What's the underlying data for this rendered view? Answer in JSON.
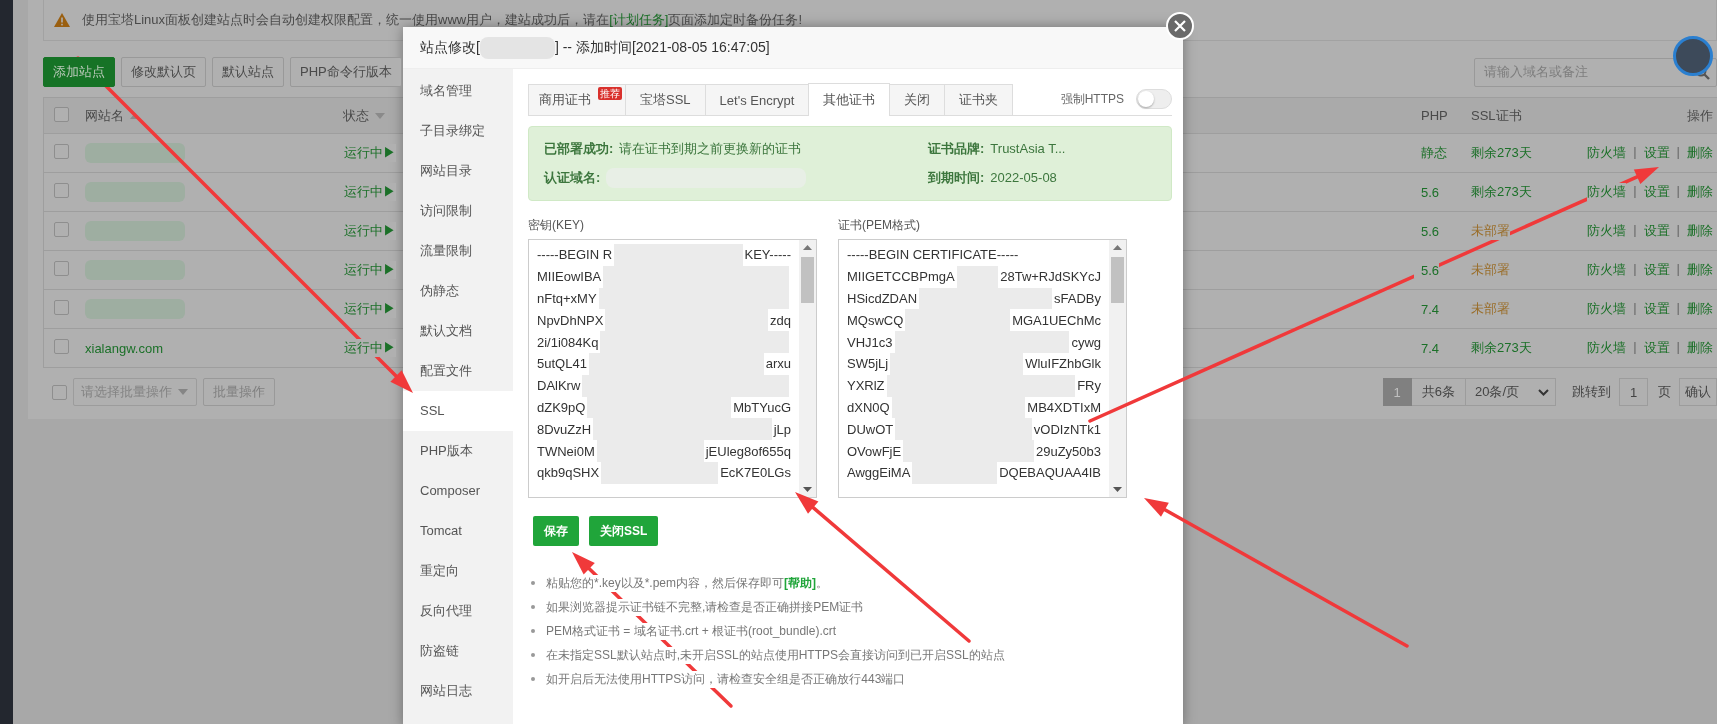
{
  "notice": {
    "text": "使用宝塔Linux面板创建站点时会自动创建权限配置，统一使用www用户，建站成功后，请在",
    "link": "[计划任务]",
    "after": "页面添加定时备份任务!"
  },
  "toolbar": [
    {
      "label": "添加站点",
      "kind": "primary"
    },
    {
      "label": "修改默认页",
      "kind": "default"
    },
    {
      "label": "默认站点",
      "kind": "default"
    },
    {
      "label": "PHP命令行版本",
      "kind": "default"
    }
  ],
  "search": {
    "placeholder": "请输入域名或备注"
  },
  "table": {
    "checked": false,
    "columns": [
      {
        "label": "网站名",
        "sort_ascending": true
      },
      {
        "label": "状态",
        "sort_ascending": false
      },
      {
        "label": "PHP"
      },
      {
        "label": "SSL证书"
      },
      {
        "label": "操作"
      }
    ],
    "rows": [
      {
        "checked": false,
        "status": "运行中▶",
        "php": "静态",
        "ssl": "剩余273天",
        "ssl_deployed": true,
        "actions": [
          "防火墙",
          "|",
          "设置",
          "|",
          "删除"
        ]
      },
      {
        "checked": false,
        "status": "运行中▶",
        "php": "5.6",
        "ssl": "剩余273天",
        "ssl_deployed": true,
        "actions": [
          "防火墙",
          "|",
          "设置",
          "|",
          "删除"
        ]
      },
      {
        "checked": false,
        "status": "运行中▶",
        "php": "5.6",
        "ssl": "未部署",
        "ssl_deployed": false,
        "actions": [
          "防火墙",
          "|",
          "设置",
          "|",
          "删除"
        ]
      },
      {
        "checked": false,
        "status": "运行中▶",
        "php": "5.6",
        "ssl": "未部署",
        "ssl_deployed": false,
        "actions": [
          "防火墙",
          "|",
          "设置",
          "|",
          "删除"
        ]
      },
      {
        "checked": false,
        "status": "运行中▶",
        "php": "7.4",
        "ssl": "未部署",
        "ssl_deployed": false,
        "actions": [
          "防火墙",
          "|",
          "设置",
          "|",
          "删除"
        ]
      },
      {
        "checked": false,
        "name": "xialangw.com",
        "status": "运行中▶",
        "php": "7.4",
        "ssl": "剩余273天",
        "ssl_deployed": true,
        "actions": [
          "防火墙",
          "|",
          "设置",
          "|",
          "删除"
        ]
      }
    ]
  },
  "batch": {
    "checked": false,
    "placeholder": "请选择批量操作",
    "button": "批量操作"
  },
  "pagination": {
    "pages": [
      {
        "label": "1",
        "selected": true
      }
    ],
    "total": "共6条",
    "page_size": "20条/页",
    "jump_label": "跳转到",
    "jump_value": "1",
    "page_unit": "页",
    "confirm": "确认"
  },
  "dialog": {
    "title": "站点修改[",
    "title_after": "] -- 添加时间[2021-08-05 16:47:05]",
    "menu": [
      {
        "label": "域名管理",
        "selected": false
      },
      {
        "label": "子目录绑定",
        "selected": false
      },
      {
        "label": "网站目录",
        "selected": false
      },
      {
        "label": "访问限制",
        "selected": false
      },
      {
        "label": "流量限制",
        "selected": false
      },
      {
        "label": "伪静态",
        "selected": false
      },
      {
        "label": "默认文档",
        "selected": false
      },
      {
        "label": "配置文件",
        "selected": false
      },
      {
        "label": "SSL",
        "selected": true
      },
      {
        "label": "PHP版本",
        "selected": false
      },
      {
        "label": "Composer",
        "selected": false
      },
      {
        "label": "Tomcat",
        "selected": false
      },
      {
        "label": "重定向",
        "selected": false
      },
      {
        "label": "反向代理",
        "selected": false
      },
      {
        "label": "防盗链",
        "selected": false
      },
      {
        "label": "网站日志",
        "selected": false
      }
    ],
    "tabs": [
      {
        "label": "商用证书",
        "selected": false,
        "badge": "推荐"
      },
      {
        "label": "宝塔SSL",
        "selected": false
      },
      {
        "label": "Let's Encrypt",
        "selected": false
      },
      {
        "label": "其他证书",
        "selected": true
      },
      {
        "label": "关闭",
        "selected": false
      },
      {
        "label": "证书夹",
        "selected": false
      }
    ],
    "force_https": {
      "label": "强制HTTPS",
      "on": false
    },
    "status": {
      "deployed_label": "已部署成功:",
      "deployed_text": "请在证书到期之前更换新的证书",
      "domain_label": "认证域名:",
      "brand_label": "证书品牌:",
      "brand": "TrustAsia T...",
      "expiry_label": "到期时间:",
      "expiry": "2022-05-08"
    },
    "key": {
      "label": "密钥(KEY)",
      "lines": [
        {
          "left": "-----BEGIN R",
          "right": "KEY-----"
        },
        {
          "left": "MIIEowIBA"
        },
        {
          "left": "nFtq+xMY"
        },
        {
          "left": "NpvDhNPX",
          "right": "zdq"
        },
        {
          "left": "2i/1i084Kq"
        },
        {
          "left": "5utQL41",
          "right": "arxu"
        },
        {
          "left": "DAlKrw"
        },
        {
          "left": "dZK9pQ",
          "right": "MbTYucG"
        },
        {
          "left": "8DvuZzH",
          "right": "jLp"
        },
        {
          "left": "TWNei0M",
          "right": "jEUleg8of655q"
        },
        {
          "left": "qkb9qSHX",
          "right": "EcK7E0LGs"
        }
      ]
    },
    "cert": {
      "label": "证书(PEM格式)",
      "lines": [
        {
          "text": "-----BEGIN CERTIFICATE-----"
        },
        {
          "left": "MIIGETCCBPmgA",
          "right": "28Tw+RJdSKYcJ"
        },
        {
          "left": "HSicdZDAN",
          "right": "sFADBy"
        },
        {
          "left": "MQswCQ",
          "right": "MGA1UEChMc"
        },
        {
          "left": "VHJ1c3",
          "right": "cywg"
        },
        {
          "left": "SW5jLj",
          "right": "WluIFZhbGlk"
        },
        {
          "left": "YXRlZ",
          "right": "FRy"
        },
        {
          "left": "dXN0Q",
          "right": "MB4XDTIxM"
        },
        {
          "left": "DUwOT",
          "right": "vODIzNTk1"
        },
        {
          "left": "OVowFjE",
          "right": "29uZy50b3"
        },
        {
          "left": "AwggEiMA",
          "right": "DQEBAQUAA4IB"
        }
      ]
    },
    "buttons": [
      "保存",
      "关闭SSL"
    ],
    "notes": [
      {
        "text": "粘贴您的*.key以及*.pem内容，然后保存即可",
        "link": "[帮助]",
        "after": "。"
      },
      {
        "text": "如果浏览器提示证书链不完整,请检查是否正确拼接PEM证书"
      },
      {
        "text": "PEM格式证书 = 域名证书.crt + 根证书(root_bundle).crt"
      },
      {
        "text": "在未指定SSL默认站点时,未开启SSL的站点使用HTTPS会直接访问到已开启SSL的站点"
      },
      {
        "text": "如开启后无法使用HTTPS访问，请检查安全组是否正确放行443端口"
      }
    ]
  }
}
